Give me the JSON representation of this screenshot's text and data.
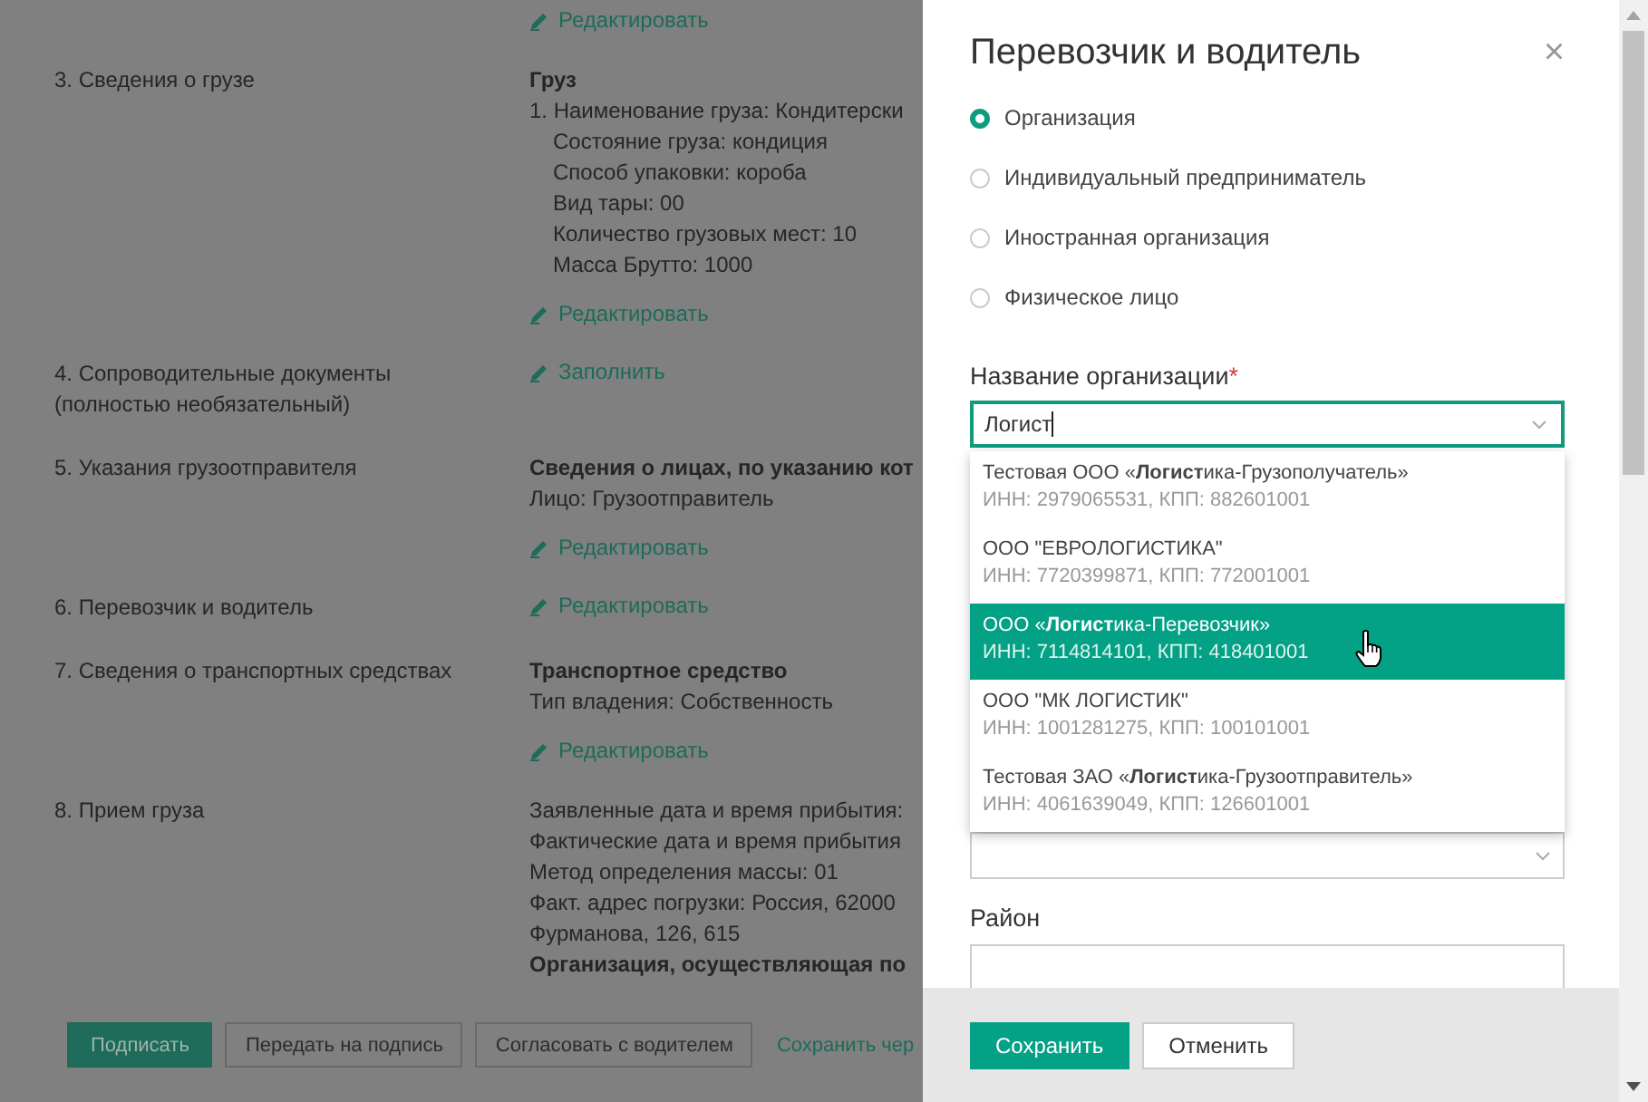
{
  "document": {
    "sections": [
      {
        "action": "Редактировать"
      },
      {
        "label": "3. Сведения о грузе",
        "content": [
          {
            "kind": "heading",
            "text": "Груз"
          },
          {
            "kind": "text",
            "text": "1. Наименование груза: Кондитерски"
          },
          {
            "kind": "indent",
            "text": "Состояние груза: кондиция"
          },
          {
            "kind": "indent",
            "text": "Способ упаковки: короба"
          },
          {
            "kind": "indent",
            "text": "Вид тары: 00"
          },
          {
            "kind": "indent",
            "text": "Количество грузовых мест: 10"
          },
          {
            "kind": "indent",
            "text": "Масса Брутто: 1000"
          }
        ],
        "action": "Редактировать"
      },
      {
        "label": "4. Сопроводительные документы (полностью необязательный)",
        "action": "Заполнить"
      },
      {
        "label": "5. Указания грузоотправителя",
        "content": [
          {
            "kind": "heading",
            "text": "Сведения о лицах, по указанию кот"
          },
          {
            "kind": "text",
            "text": "Лицо: Грузоотправитель"
          }
        ],
        "action": "Редактировать"
      },
      {
        "label": "6. Перевозчик и водитель",
        "action": "Редактировать"
      },
      {
        "label": "7. Сведения о транспортных средствах",
        "content": [
          {
            "kind": "heading",
            "text": "Транспортное средство"
          },
          {
            "kind": "text",
            "text": "Тип владения: Собственность"
          }
        ],
        "action": "Редактировать"
      },
      {
        "label": "8. Прием груза",
        "content": [
          {
            "kind": "text",
            "text": "Заявленные дата и время прибытия:"
          },
          {
            "kind": "text",
            "text": "Фактические дата и время прибытия"
          },
          {
            "kind": "text",
            "text": "Метод определения массы: 01"
          },
          {
            "kind": "text",
            "text": "Факт. адрес погрузки: Россия, 62000"
          },
          {
            "kind": "text",
            "text": "Фурманова, 126, 615"
          },
          {
            "kind": "heading",
            "text": "Организация, осуществляющая по"
          }
        ]
      }
    ],
    "footer": [
      {
        "kind": "primary",
        "label": "Подписать"
      },
      {
        "kind": "secondary",
        "label": "Передать на подпись"
      },
      {
        "kind": "secondary",
        "label": "Согласовать с водителем"
      },
      {
        "kind": "link",
        "label": "Сохранить чер"
      }
    ]
  },
  "panel": {
    "title": "Перевозчик и водитель",
    "close": "×",
    "radios": [
      {
        "label": "Организация",
        "selected": true
      },
      {
        "label": "Индивидуальный предприниматель",
        "selected": false
      },
      {
        "label": "Иностранная организация",
        "selected": false
      },
      {
        "label": "Физическое лицо",
        "selected": false
      }
    ],
    "org_field": {
      "label": "Название организации",
      "required_mark": "*",
      "value": "Логист",
      "options": [
        {
          "name": "Тестовая ООО «**Логист**ика-Грузополучатель»",
          "details": "ИНН: 2979065531, КПП: 882601001",
          "selected": false
        },
        {
          "name": "ООО \"ЕВРОЛОГИСТИКА\"",
          "details": "ИНН: 7720399871, КПП: 772001001",
          "selected": false
        },
        {
          "name": "ООО «**Логист**ика-Перевозчик»",
          "details": "ИНН: 7114814101, КПП: 418401001",
          "selected": true
        },
        {
          "name": "ООО \"МК ЛОГИСТИК\"",
          "details": "ИНН: 1001281275, КПП: 100101001",
          "selected": false
        },
        {
          "name": "Тестовая ЗАО «**Логист**ика-Грузоотправитель»",
          "details": "ИНН: 4061639049, КПП: 126601001",
          "selected": false
        }
      ]
    },
    "district_label": "Район",
    "buttons": [
      {
        "kind": "primary",
        "label": "Сохранить"
      },
      {
        "kind": "secondary",
        "label": "Отменить"
      }
    ]
  }
}
